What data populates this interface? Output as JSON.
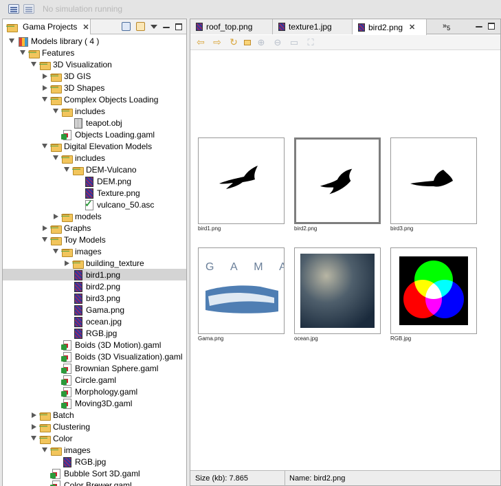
{
  "topbar": {
    "status": "No simulation running"
  },
  "left_panel": {
    "tab_label": "Gama Projects",
    "tree": [
      {
        "label": "Models library ( 4 )",
        "icon": "library-icon",
        "depth": 0,
        "twisty": "open"
      },
      {
        "label": "Features",
        "icon": "folder-icon",
        "depth": 1,
        "twisty": "open"
      },
      {
        "label": "3D Visualization",
        "icon": "folder-icon",
        "depth": 2,
        "twisty": "open"
      },
      {
        "label": "3D GIS",
        "icon": "folder-icon",
        "depth": 3,
        "twisty": "closed"
      },
      {
        "label": "3D Shapes",
        "icon": "folder-icon",
        "depth": 3,
        "twisty": "closed"
      },
      {
        "label": "Complex Objects Loading",
        "icon": "folder-icon",
        "depth": 3,
        "twisty": "open"
      },
      {
        "label": "includes",
        "icon": "folder-icon",
        "depth": 4,
        "twisty": "open"
      },
      {
        "label": "teapot.obj",
        "icon": "obj-file-icon",
        "depth": 5,
        "twisty": "none"
      },
      {
        "label": "Objects Loading.gaml",
        "icon": "gaml-file-icon",
        "depth": 4,
        "twisty": "none"
      },
      {
        "label": "Digital Elevation Models",
        "icon": "folder-icon",
        "depth": 3,
        "twisty": "open"
      },
      {
        "label": "includes",
        "icon": "folder-icon",
        "depth": 4,
        "twisty": "open"
      },
      {
        "label": "DEM-Vulcano",
        "icon": "folder-icon",
        "depth": 5,
        "twisty": "open"
      },
      {
        "label": "DEM.png",
        "icon": "image-file-icon",
        "depth": 6,
        "twisty": "none"
      },
      {
        "label": "Texture.png",
        "icon": "image-file-icon",
        "depth": 6,
        "twisty": "none"
      },
      {
        "label": "vulcano_50.asc",
        "icon": "asc-file-icon",
        "depth": 6,
        "twisty": "none"
      },
      {
        "label": "models",
        "icon": "folder-icon",
        "depth": 4,
        "twisty": "closed"
      },
      {
        "label": "Graphs",
        "icon": "folder-icon",
        "depth": 3,
        "twisty": "closed"
      },
      {
        "label": "Toy Models",
        "icon": "folder-icon",
        "depth": 3,
        "twisty": "open"
      },
      {
        "label": "images",
        "icon": "folder-icon",
        "depth": 4,
        "twisty": "open"
      },
      {
        "label": "building_texture",
        "icon": "folder-icon",
        "depth": 5,
        "twisty": "closed"
      },
      {
        "label": "bird1.png",
        "icon": "image-file-icon",
        "depth": 5,
        "twisty": "none",
        "selected": true
      },
      {
        "label": "bird2.png",
        "icon": "image-file-icon",
        "depth": 5,
        "twisty": "none"
      },
      {
        "label": "bird3.png",
        "icon": "image-file-icon",
        "depth": 5,
        "twisty": "none"
      },
      {
        "label": "Gama.png",
        "icon": "image-file-icon",
        "depth": 5,
        "twisty": "none"
      },
      {
        "label": "ocean.jpg",
        "icon": "image-file-icon",
        "depth": 5,
        "twisty": "none"
      },
      {
        "label": "RGB.jpg",
        "icon": "image-file-icon",
        "depth": 5,
        "twisty": "none"
      },
      {
        "label": "Boids (3D Motion).gaml",
        "icon": "gaml-file-icon",
        "depth": 4,
        "twisty": "none"
      },
      {
        "label": "Boids (3D Visualization).gaml",
        "icon": "gaml-file-icon",
        "depth": 4,
        "twisty": "none"
      },
      {
        "label": "Brownian Sphere.gaml",
        "icon": "gaml-file-icon",
        "depth": 4,
        "twisty": "none"
      },
      {
        "label": "Circle.gaml",
        "icon": "gaml-file-icon",
        "depth": 4,
        "twisty": "none"
      },
      {
        "label": "Morphology.gaml",
        "icon": "gaml-file-icon",
        "depth": 4,
        "twisty": "none"
      },
      {
        "label": "Moving3D.gaml",
        "icon": "gaml-file-icon",
        "depth": 4,
        "twisty": "none"
      },
      {
        "label": "Batch",
        "icon": "folder-icon",
        "depth": 2,
        "twisty": "closed"
      },
      {
        "label": "Clustering",
        "icon": "folder-icon",
        "depth": 2,
        "twisty": "closed"
      },
      {
        "label": "Color",
        "icon": "folder-icon",
        "depth": 2,
        "twisty": "open"
      },
      {
        "label": "images",
        "icon": "folder-icon",
        "depth": 3,
        "twisty": "open"
      },
      {
        "label": "RGB.jpg",
        "icon": "image-file-icon",
        "depth": 4,
        "twisty": "none"
      },
      {
        "label": "Bubble Sort 3D.gaml",
        "icon": "gaml-file-icon",
        "depth": 3,
        "twisty": "none"
      },
      {
        "label": "Color Brewer.gaml",
        "icon": "gaml-file-icon",
        "depth": 3,
        "twisty": "none"
      }
    ]
  },
  "editor": {
    "tabs": [
      {
        "label": "roof_top.png",
        "active": false
      },
      {
        "label": "texture1.jpg",
        "active": false
      },
      {
        "label": "bird2.png",
        "active": true
      }
    ],
    "overflow_count": "5",
    "thumbnails": [
      {
        "caption": "bird1.png",
        "selected": false,
        "kind": "bird1"
      },
      {
        "caption": "bird2.png",
        "selected": true,
        "kind": "bird2"
      },
      {
        "caption": "bird3.png",
        "selected": false,
        "kind": "bird3"
      },
      {
        "caption": "Gama.png",
        "selected": false,
        "kind": "gama"
      },
      {
        "caption": "ocean.jpg",
        "selected": false,
        "kind": "ocean"
      },
      {
        "caption": "RGB.jpg",
        "selected": false,
        "kind": "rgb"
      }
    ],
    "gama_logo_text": "G A M A",
    "status": {
      "size": "Size (kb): 7.865",
      "name": "Name: bird2.png"
    }
  }
}
